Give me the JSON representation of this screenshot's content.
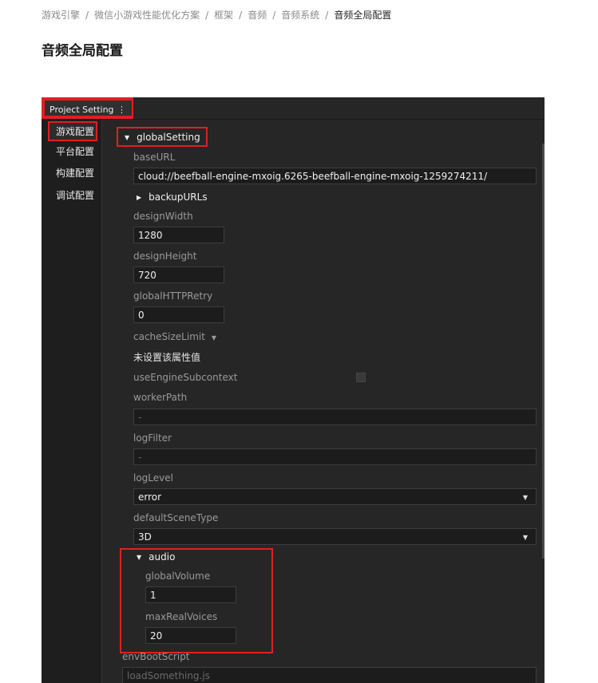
{
  "breadcrumb": {
    "items": [
      "游戏引擎",
      "微信小游戏性能优化方案",
      "框架",
      "音频",
      "音频系统"
    ],
    "current": "音频全局配置",
    "separator": "/"
  },
  "page_title": "音频全局配置",
  "panel": {
    "tab_label": "Project Setting",
    "tab_more_icon": "⋮",
    "sidebar": [
      "游戏配置",
      "平台配置",
      "构建配置",
      "调试配置"
    ],
    "global_setting": {
      "label": "globalSetting",
      "base_url_label": "baseURL",
      "base_url_value": "cloud://beefball-engine-mxoig.6265-beefball-engine-mxoig-1259274211/",
      "backup_urls_label": "backupURLs",
      "design_width_label": "designWidth",
      "design_width_value": "1280",
      "design_height_label": "designHeight",
      "design_height_value": "720",
      "retry_label": "globalHTTPRetry",
      "retry_value": "0",
      "cache_label": "cacheSizeLimit",
      "cache_value": "未设置该属性值",
      "subcontext_label": "useEngineSubcontext",
      "worker_label": "workerPath",
      "worker_value": "-",
      "log_filter_label": "logFilter",
      "log_filter_value": "-",
      "log_level_label": "logLevel",
      "log_level_value": "error",
      "scene_type_label": "defaultSceneType",
      "scene_type_value": "3D"
    },
    "audio": {
      "label": "audio",
      "volume_label": "globalVolume",
      "volume_value": "1",
      "voices_label": "maxRealVoices",
      "voices_value": "20"
    },
    "env_boot_label": "envBootScript",
    "env_boot_value": "loadSomething.js"
  },
  "colors": {
    "highlight": "#e02020",
    "panel_bg": "#262626"
  }
}
